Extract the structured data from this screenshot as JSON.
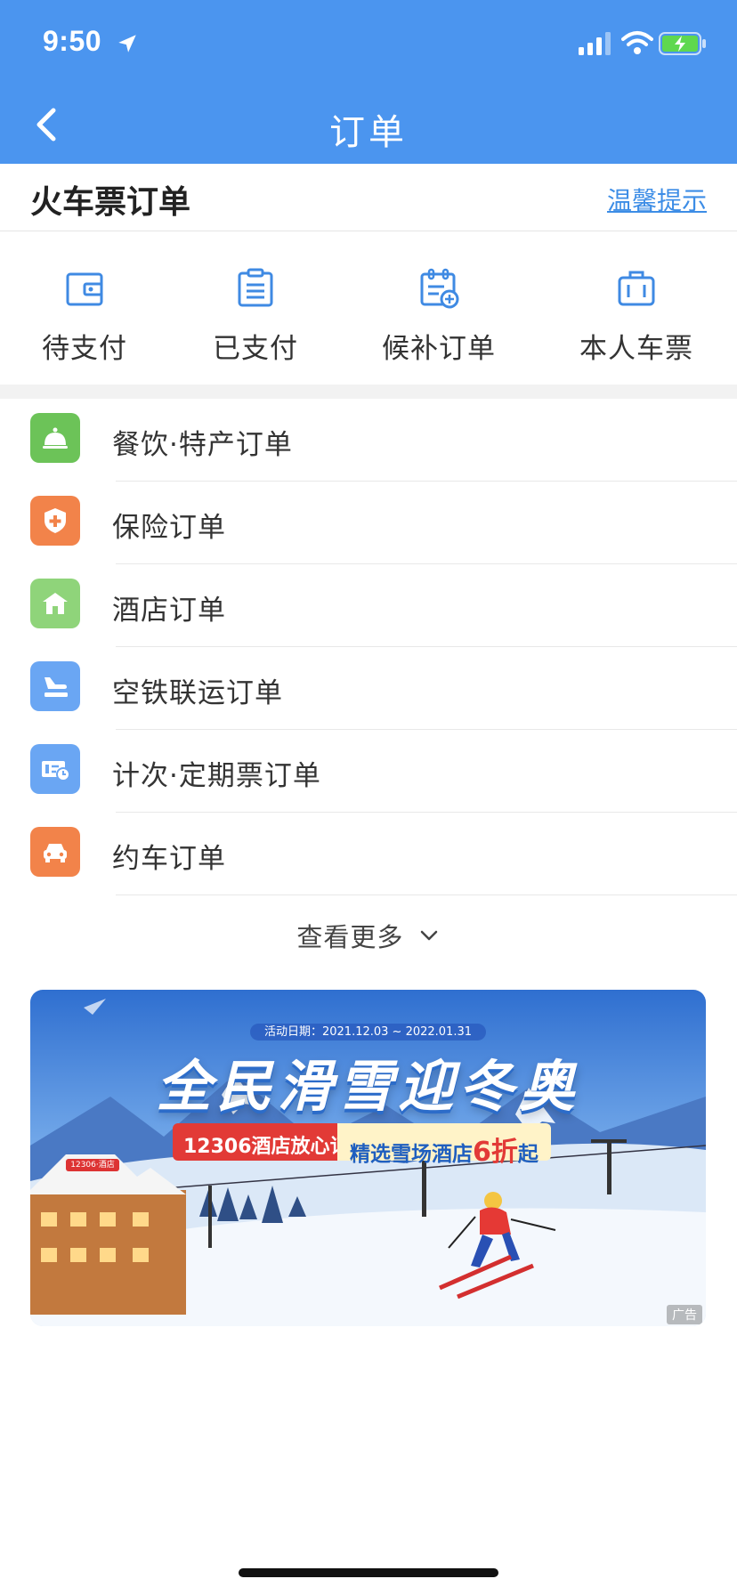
{
  "status_bar": {
    "time": "9:50"
  },
  "header": {
    "title": "订单"
  },
  "section": {
    "title": "火车票订单",
    "tips": "温馨提示"
  },
  "quick_entries": [
    {
      "label": "待支付",
      "icon": "wallet-icon"
    },
    {
      "label": "已支付",
      "icon": "clipboard-list-icon"
    },
    {
      "label": "候补订单",
      "icon": "calendar-add-icon"
    },
    {
      "label": "本人车票",
      "icon": "suitcase-icon"
    }
  ],
  "orders": [
    {
      "label": "餐饮·特产订单",
      "icon": "service-bell-icon",
      "color": "#6cc358"
    },
    {
      "label": "保险订单",
      "icon": "shield-plus-icon",
      "color": "#f2834a"
    },
    {
      "label": "酒店订单",
      "icon": "hotel-icon",
      "color": "#8fd47a"
    },
    {
      "label": "空铁联运订单",
      "icon": "plane-train-icon",
      "color": "#6aa6f3"
    },
    {
      "label": "计次·定期票订单",
      "icon": "ticket-clock-icon",
      "color": "#6aa6f3"
    },
    {
      "label": "约车订单",
      "icon": "car-icon",
      "color": "#f2834a"
    }
  ],
  "more": {
    "label": "查看更多"
  },
  "banner": {
    "date": "活动日期：2021.12.03 ~ 2022.01.31",
    "title": "全民滑雪迎冬奥",
    "tag_left": "12306酒店放心订",
    "tag_right_prefix": "精选雪场酒店",
    "tag_right_highlight": "6折",
    "tag_right_suffix": "起",
    "hotel_sign": "12306·酒店",
    "ad_label": "广告"
  },
  "colors": {
    "header_bg": "#4b95ef",
    "link": "#3d8de6"
  }
}
